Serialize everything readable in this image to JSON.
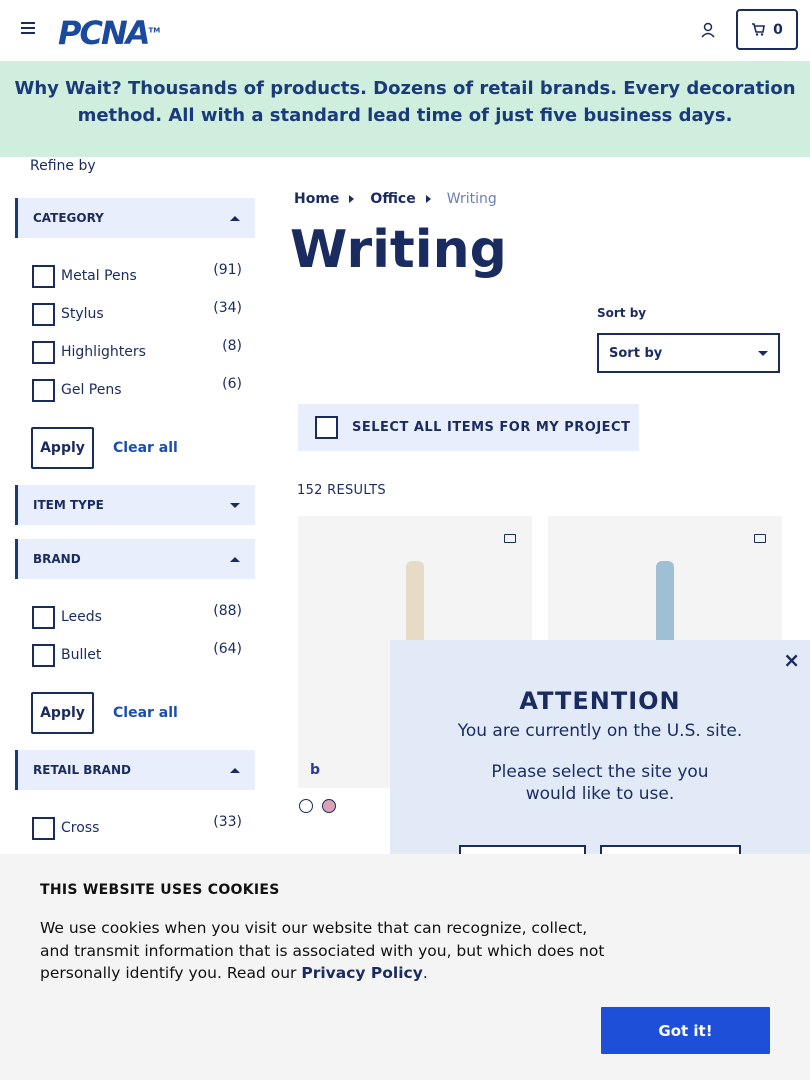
{
  "header": {
    "logo_text": "PCNA",
    "logo_tm": "TM",
    "cart_count": "0"
  },
  "banner": {
    "lead": "Why Wait?",
    "text": " Thousands of products. Dozens of retail brands. Every decoration method. All with a standard lead time of just five business days."
  },
  "sidebar": {
    "refine_label": "Refine by",
    "category": {
      "title": "CATEGORY",
      "items": [
        {
          "label": "Metal Pens",
          "count": "(91)"
        },
        {
          "label": "Stylus",
          "count": "(34)"
        },
        {
          "label": "Highlighters",
          "count": "(8)"
        },
        {
          "label": "Gel Pens",
          "count": "(6)"
        }
      ],
      "apply_label": "Apply",
      "clear_label": "Clear all"
    },
    "item_type": {
      "title": "ITEM TYPE"
    },
    "brand": {
      "title": "BRAND",
      "items": [
        {
          "label": "Leeds",
          "count": "(88)"
        },
        {
          "label": "Bullet",
          "count": "(64)"
        }
      ],
      "apply_label": "Apply",
      "clear_label": "Clear all"
    },
    "retail_brand": {
      "title": "RETAIL BRAND",
      "items": [
        {
          "label": "Cross",
          "count": "(33)"
        }
      ]
    }
  },
  "main": {
    "breadcrumb": [
      "Home",
      "Office",
      "Writing"
    ],
    "title": "Writing",
    "sort_label": "Sort by",
    "sort_value": "Sort by",
    "select_all_label": "SELECT ALL ITEMS FOR MY PROJECT",
    "results_label": "152 RESULTS",
    "cards": [
      {
        "pen_color": "#e6dcc6",
        "brand_mark": "b"
      },
      {
        "pen_color": "#9fc0d4"
      }
    ],
    "swatches": [
      "#ffffff",
      "#d9a3b5"
    ]
  },
  "modal": {
    "close_label": "×",
    "title": "ATTENTION",
    "subtitle": "You are currently on the U.S. site.",
    "prompt": "Please select the site you would like to use."
  },
  "cookie": {
    "title": "THIS WEBSITE USES COOKIES",
    "text": "We use cookies when you visit our website that can recognize, collect, and transmit information that is associated with you, but which does not personally identify you. Read our ",
    "link": "Privacy Policy",
    "end": ".",
    "button_label": "Got it!"
  }
}
